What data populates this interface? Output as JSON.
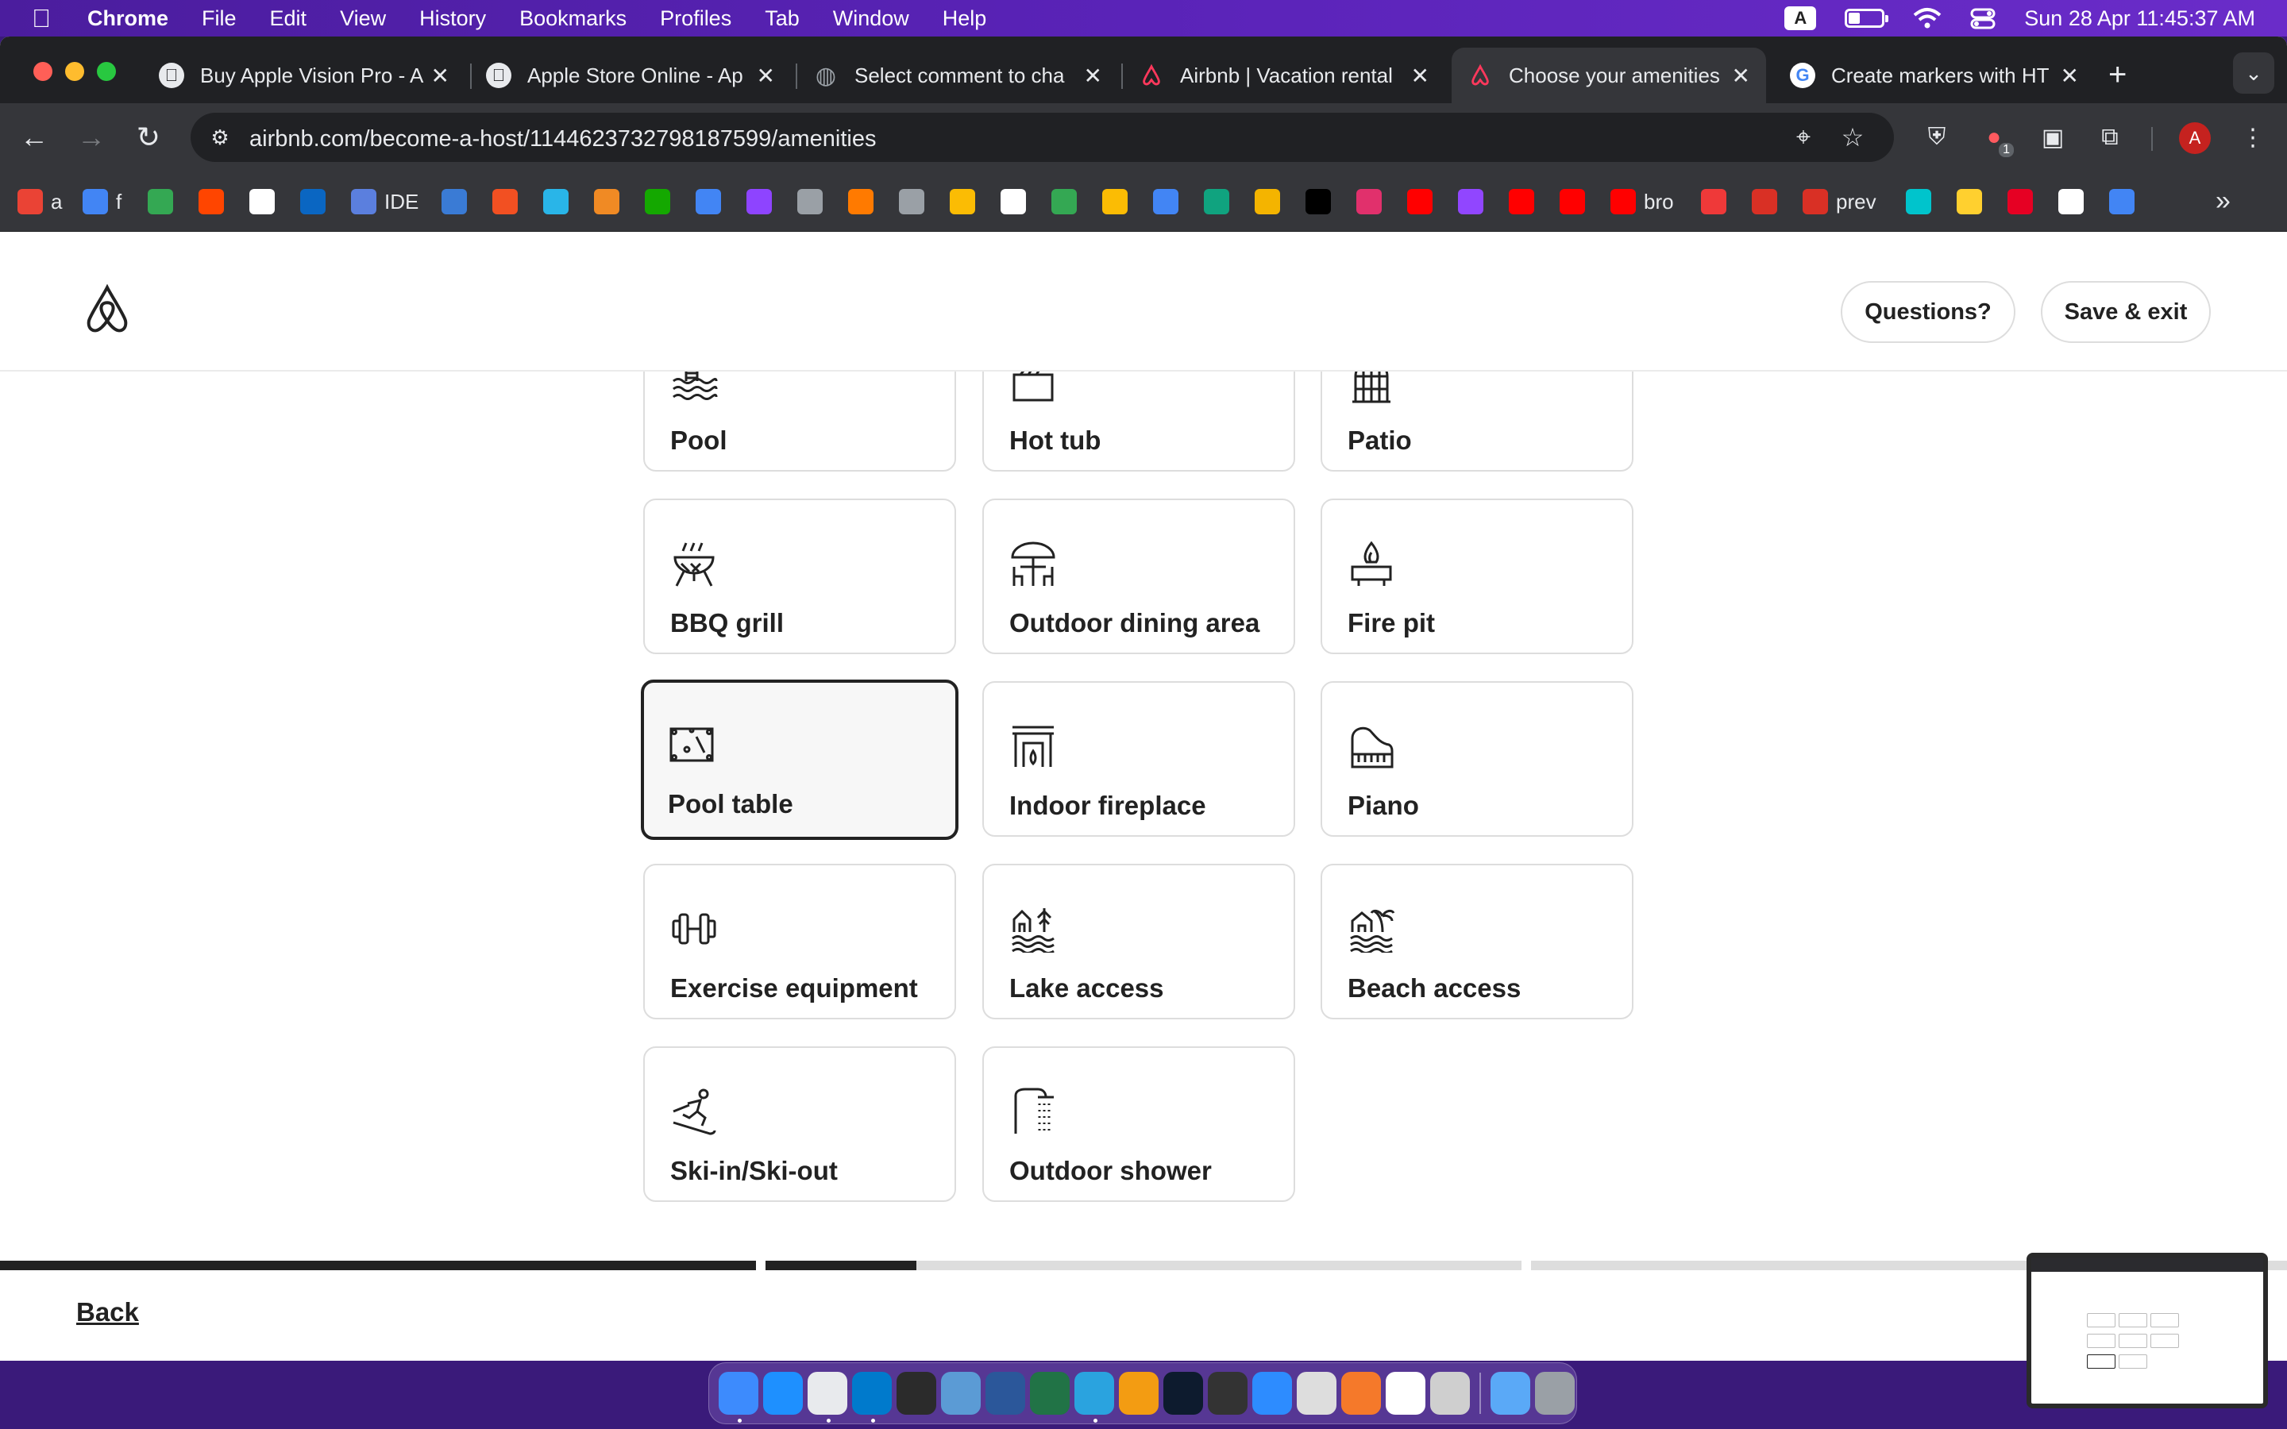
{
  "menubar": {
    "app_name": "Chrome",
    "items": [
      "File",
      "Edit",
      "View",
      "History",
      "Bookmarks",
      "Profiles",
      "Tab",
      "Window",
      "Help"
    ],
    "input_source": "A",
    "datetime": "Sun 28 Apr  11:45:37 AM"
  },
  "tabs": [
    {
      "title": "Buy Apple Vision Pro - A",
      "icon": "apple-icon",
      "active": false
    },
    {
      "title": "Apple Store Online - Ap",
      "icon": "apple-icon",
      "active": false
    },
    {
      "title": "Select comment to cha",
      "icon": "globe-icon",
      "active": false
    },
    {
      "title": "Airbnb | Vacation rental",
      "icon": "airbnb-icon",
      "active": false
    },
    {
      "title": "Choose your amenities",
      "icon": "airbnb-icon",
      "active": true
    },
    {
      "title": "Create markers with HT",
      "icon": "google-icon",
      "active": false
    }
  ],
  "toolbar": {
    "url": "airbnb.com/become-a-host/1144623732798187599/amenities",
    "extension_badge": "1",
    "profile_initial": "A"
  },
  "bookmarks": [
    {
      "label": "a",
      "icon": "gmail-icon",
      "color": "#ea4335"
    },
    {
      "label": "f",
      "icon": "gmail-icon",
      "color": "#4285f4"
    },
    {
      "label": "",
      "icon": "meet-icon",
      "color": "#34a853"
    },
    {
      "label": "",
      "icon": "reddit-icon",
      "color": "#ff4500"
    },
    {
      "label": "",
      "icon": "github-icon",
      "color": "#ffffff"
    },
    {
      "label": "",
      "icon": "linkedin-icon",
      "color": "#0a66c2"
    },
    {
      "label": "IDE",
      "icon": "sql-icon",
      "color": "#5b7fde"
    },
    {
      "label": "",
      "icon": "app-icon",
      "color": "#3a7bd5"
    },
    {
      "label": "",
      "icon": "microsoft-icon",
      "color": "#f25022"
    },
    {
      "label": "",
      "icon": "snowflake-icon",
      "color": "#29b5e8"
    },
    {
      "label": "",
      "icon": "box-icon",
      "color": "#f08a24"
    },
    {
      "label": "",
      "icon": "upwork-icon",
      "color": "#14a800"
    },
    {
      "label": "",
      "icon": "docs-icon",
      "color": "#4285f4"
    },
    {
      "label": "",
      "icon": "app-icon",
      "color": "#8e44ff"
    },
    {
      "label": "",
      "icon": "globe-icon",
      "color": "#9aa0a6"
    },
    {
      "label": "",
      "icon": "runner-icon",
      "color": "#ff7a00"
    },
    {
      "label": "",
      "icon": "hd-icon",
      "color": "#9aa0a6"
    },
    {
      "label": "",
      "icon": "emoji-icon",
      "color": "#fbbc04"
    },
    {
      "label": "",
      "icon": "google-icon",
      "color": "#ffffff"
    },
    {
      "label": "",
      "icon": "maps-icon",
      "color": "#34a853"
    },
    {
      "label": "",
      "icon": "app-icon",
      "color": "#fbbc04"
    },
    {
      "label": "",
      "icon": "chat-icon",
      "color": "#4285f4"
    },
    {
      "label": "",
      "icon": "openai-icon",
      "color": "#10a37f"
    },
    {
      "label": "",
      "icon": "mt-icon",
      "color": "#f4b400"
    },
    {
      "label": "",
      "icon": "tiktok-icon",
      "color": "#000000"
    },
    {
      "label": "",
      "icon": "instagram-icon",
      "color": "#e1306c"
    },
    {
      "label": "",
      "icon": "youtube-icon",
      "color": "#ff0000"
    },
    {
      "label": "",
      "icon": "twitch-icon",
      "color": "#9146ff"
    },
    {
      "label": "",
      "icon": "youtube-icon",
      "color": "#ff0000"
    },
    {
      "label": "",
      "icon": "youtube-icon",
      "color": "#ff0000"
    },
    {
      "label": "bro",
      "icon": "youtube-icon",
      "color": "#ff0000"
    },
    {
      "label": "",
      "icon": "vivaldi-icon",
      "color": "#ef3939"
    },
    {
      "label": "",
      "icon": "chart-icon",
      "color": "#d93025"
    },
    {
      "label": "prev",
      "icon": "chart-icon",
      "color": "#d93025"
    },
    {
      "label": "",
      "icon": "canva-icon",
      "color": "#00c4cc"
    },
    {
      "label": "",
      "icon": "miro-icon",
      "color": "#ffd02f"
    },
    {
      "label": "",
      "icon": "pinterest-icon",
      "color": "#e60023"
    },
    {
      "label": "",
      "icon": "threads-icon",
      "color": "#ffffff"
    },
    {
      "label": "",
      "icon": "gemini-icon",
      "color": "#4285f4"
    }
  ],
  "airbnb": {
    "questions_label": "Questions?",
    "save_exit_label": "Save & exit",
    "back_label": "Back",
    "brand_color": "#ff385c",
    "progress": [
      1.0,
      0.2,
      0.0
    ]
  },
  "amenities": [
    {
      "label": "Pool",
      "icon": "pool-icon",
      "selected": false
    },
    {
      "label": "Hot tub",
      "icon": "hot-tub-icon",
      "selected": false
    },
    {
      "label": "Patio",
      "icon": "patio-icon",
      "selected": false
    },
    {
      "label": "BBQ grill",
      "icon": "bbq-grill-icon",
      "selected": false
    },
    {
      "label": "Outdoor dining area",
      "icon": "outdoor-dining-icon",
      "selected": false
    },
    {
      "label": "Fire pit",
      "icon": "fire-pit-icon",
      "selected": false
    },
    {
      "label": "Pool table",
      "icon": "pool-table-icon",
      "selected": true
    },
    {
      "label": "Indoor fireplace",
      "icon": "fireplace-icon",
      "selected": false
    },
    {
      "label": "Piano",
      "icon": "piano-icon",
      "selected": false
    },
    {
      "label": "Exercise equipment",
      "icon": "dumbbell-icon",
      "selected": false
    },
    {
      "label": "Lake access",
      "icon": "lake-icon",
      "selected": false
    },
    {
      "label": "Beach access",
      "icon": "beach-icon",
      "selected": false
    },
    {
      "label": "Ski-in/Ski-out",
      "icon": "skier-icon",
      "selected": false
    },
    {
      "label": "Outdoor shower",
      "icon": "shower-icon",
      "selected": false
    }
  ],
  "dock": [
    {
      "icon": "finder-icon",
      "color": "#3d8bfd",
      "running": true
    },
    {
      "icon": "safari-icon",
      "color": "#1e90ff",
      "running": false
    },
    {
      "icon": "chrome-icon",
      "color": "#e8eaed",
      "running": true
    },
    {
      "icon": "vscode-icon",
      "color": "#007acc",
      "running": true
    },
    {
      "icon": "terminal-icon",
      "color": "#2b2b2b",
      "running": false
    },
    {
      "icon": "app-icon",
      "color": "#5b9bd5",
      "running": false
    },
    {
      "icon": "word-icon",
      "color": "#2b579a",
      "running": false
    },
    {
      "icon": "excel-icon",
      "color": "#217346",
      "running": false
    },
    {
      "icon": "telegram-icon",
      "color": "#2aa3df",
      "running": true
    },
    {
      "icon": "pages-icon",
      "color": "#f39c12",
      "running": false
    },
    {
      "icon": "photoshop-icon",
      "color": "#0d1b2e",
      "running": false
    },
    {
      "icon": "claquette-icon",
      "color": "#333333",
      "running": false
    },
    {
      "icon": "zoom-icon",
      "color": "#2d8cff",
      "running": false
    },
    {
      "icon": "unity-icon",
      "color": "#dddddd",
      "running": false
    },
    {
      "icon": "blender-icon",
      "color": "#f5792a",
      "running": false
    },
    {
      "icon": "notion-icon",
      "color": "#ffffff",
      "running": false
    },
    {
      "icon": "chatgpt-icon",
      "color": "#cfcfcf",
      "running": false
    },
    {
      "icon": "folder-icon",
      "color": "#5aa9f7",
      "running": false
    },
    {
      "icon": "trash-icon",
      "color": "#9aa0a6",
      "running": false
    }
  ]
}
